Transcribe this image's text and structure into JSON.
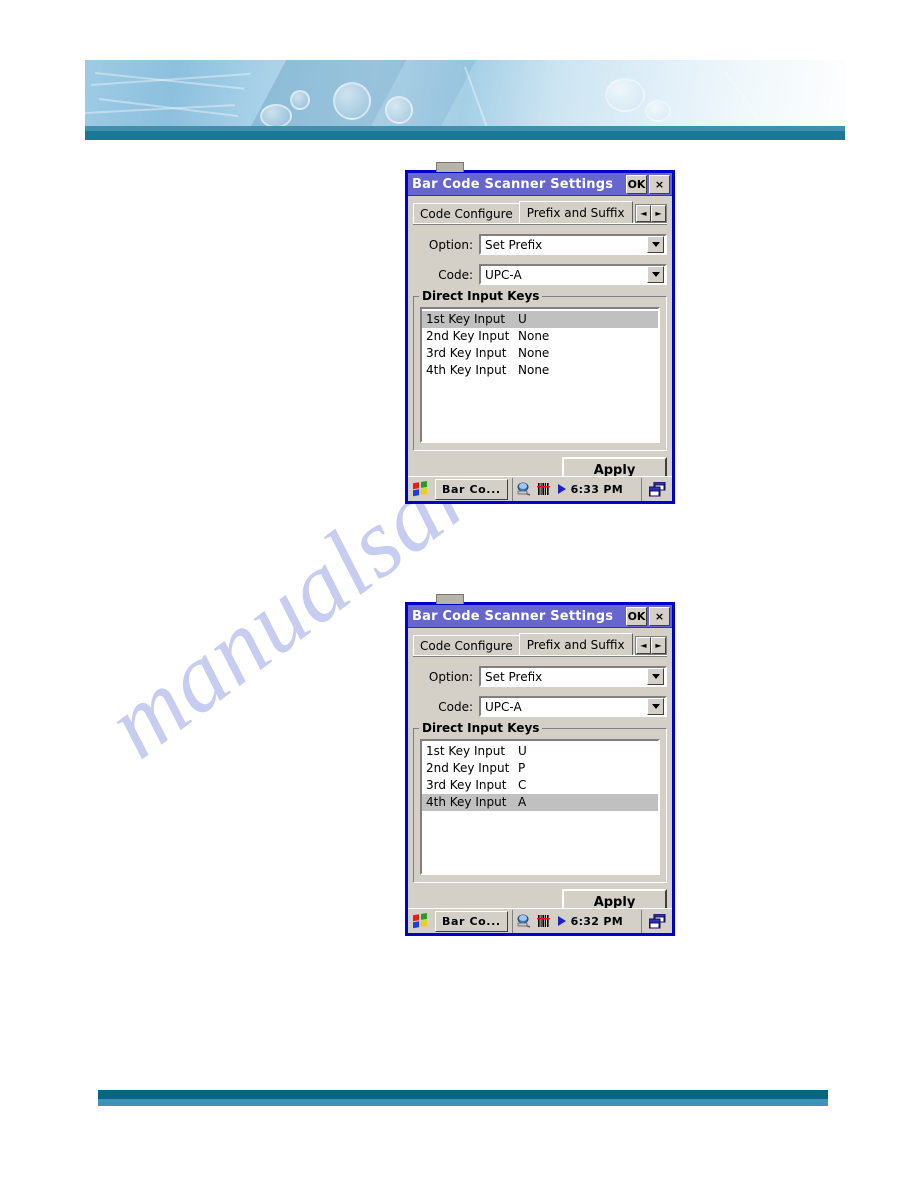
{
  "page": {
    "background": "#ffffff",
    "banner": {
      "accent_dark": "#1b7798",
      "accent_mid": "#3f8fad"
    },
    "footer": {
      "line1_color": "#0c6484",
      "line2_color": "#3e93b9"
    },
    "watermark": {
      "text": "manualsarchive.com",
      "color": "#c6cdf0"
    }
  },
  "dialogs": [
    {
      "title": "Bar Code Scanner Settings",
      "ok_label": "OK",
      "close_label": "×",
      "tabs": [
        {
          "label": "Code Configure",
          "active": false
        },
        {
          "label": "Prefix and Suffix",
          "active": true
        }
      ],
      "tab_prev_icon": "◄",
      "tab_next_icon": "►",
      "fields": [
        {
          "label": "Option:",
          "value": "Set Prefix"
        },
        {
          "label": "Code:",
          "value": "UPC-A"
        }
      ],
      "group_title": "Direct Input Keys",
      "list": [
        {
          "name": "1st  Key Input",
          "value": "U",
          "selected": true
        },
        {
          "name": "2nd Key Input",
          "value": "None",
          "selected": false
        },
        {
          "name": "3rd Key Input",
          "value": "None",
          "selected": false
        },
        {
          "name": "4th Key Input",
          "value": "None",
          "selected": false
        }
      ],
      "apply_label": "Apply",
      "taskbar": {
        "start_icon": "windows-flag-icon",
        "task_label": "Bar Co...",
        "tray_icons": [
          "desktop-scanner-icon",
          "barcode-icon",
          "play-arrow-icon"
        ],
        "clock": "6:33 PM",
        "right_icon": "switch-windows-icon"
      }
    },
    {
      "title": "Bar Code Scanner Settings",
      "ok_label": "OK",
      "close_label": "×",
      "tabs": [
        {
          "label": "Code Configure",
          "active": false
        },
        {
          "label": "Prefix and Suffix",
          "active": true
        }
      ],
      "tab_prev_icon": "◄",
      "tab_next_icon": "►",
      "fields": [
        {
          "label": "Option:",
          "value": "Set Prefix"
        },
        {
          "label": "Code:",
          "value": "UPC-A"
        }
      ],
      "group_title": "Direct Input Keys",
      "list": [
        {
          "name": "1st  Key Input",
          "value": "U",
          "selected": false
        },
        {
          "name": "2nd Key Input",
          "value": "P",
          "selected": false
        },
        {
          "name": "3rd Key Input",
          "value": "C",
          "selected": false
        },
        {
          "name": "4th Key Input",
          "value": "A",
          "selected": true
        }
      ],
      "apply_label": "Apply",
      "taskbar": {
        "start_icon": "windows-flag-icon",
        "task_label": "Bar Co...",
        "tray_icons": [
          "desktop-scanner-icon",
          "barcode-icon",
          "play-arrow-icon"
        ],
        "clock": "6:32 PM",
        "right_icon": "switch-windows-icon"
      }
    }
  ]
}
